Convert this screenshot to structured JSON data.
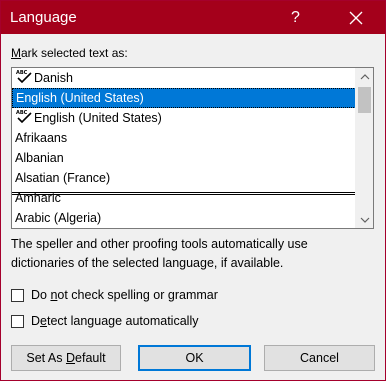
{
  "window": {
    "title": "Language",
    "help_label": "?",
    "accent_color": "#a4001b"
  },
  "mark_label": {
    "accel": "M",
    "rest": "ark selected text as:"
  },
  "languages": {
    "items": [
      {
        "label": "Danish",
        "proofing": true,
        "selected": false
      },
      {
        "label": "English (United States)",
        "proofing": false,
        "selected": true
      },
      {
        "label": "English (United States)",
        "proofing": true,
        "selected": false
      },
      {
        "label": "Afrikaans",
        "proofing": false,
        "selected": false
      },
      {
        "label": "Albanian",
        "proofing": false,
        "selected": false
      },
      {
        "label": "Alsatian (France)",
        "proofing": false,
        "selected": false
      },
      {
        "label": "Amharic",
        "proofing": false,
        "selected": false
      },
      {
        "label": "Arabic (Algeria)",
        "proofing": false,
        "selected": false
      }
    ],
    "selection_color": "#0078d7"
  },
  "description": "The speller and other proofing tools automatically use dictionaries of the selected language, if available.",
  "options": {
    "no_check": {
      "pre": "Do ",
      "accel": "n",
      "post": "ot check spelling or grammar",
      "checked": false
    },
    "detect": {
      "pre": "D",
      "accel": "e",
      "post": "tect language automatically",
      "checked": false
    }
  },
  "buttons": {
    "set_default": {
      "pre": "Set As ",
      "accel": "D",
      "post": "efault"
    },
    "ok": "OK",
    "cancel": "Cancel"
  }
}
